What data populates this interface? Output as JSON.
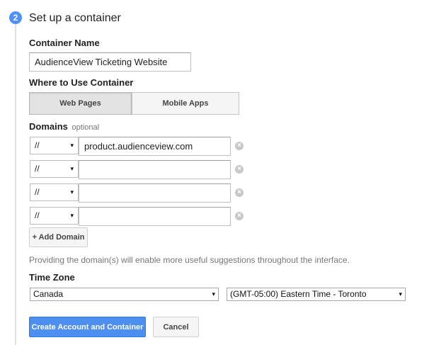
{
  "step": {
    "number": "2",
    "title": "Set up a container"
  },
  "container_name": {
    "label": "Container Name",
    "value": "AudienceView Ticketing Website"
  },
  "where_to_use": {
    "label": "Where to Use Container",
    "options": [
      "Web Pages",
      "Mobile Apps"
    ],
    "selected": "Web Pages"
  },
  "domains": {
    "label": "Domains",
    "optional_label": "optional",
    "rows": [
      {
        "protocol": "//",
        "value": "product.audienceview.com"
      },
      {
        "protocol": "//",
        "value": ""
      },
      {
        "protocol": "//",
        "value": ""
      },
      {
        "protocol": "//",
        "value": ""
      }
    ],
    "add_label": "+ Add Domain",
    "hint": "Providing the domain(s) will enable more useful suggestions throughout the interface."
  },
  "time_zone": {
    "label": "Time Zone",
    "country": "Canada",
    "zone": "(GMT-05:00) Eastern Time - Toronto"
  },
  "actions": {
    "create_label": "Create Account and Container",
    "cancel_label": "Cancel"
  },
  "icons": {
    "dropdown": "▾",
    "remove": "×"
  },
  "colors": {
    "accent": "#4d90fe",
    "primary_button": "#4d8ff0"
  }
}
